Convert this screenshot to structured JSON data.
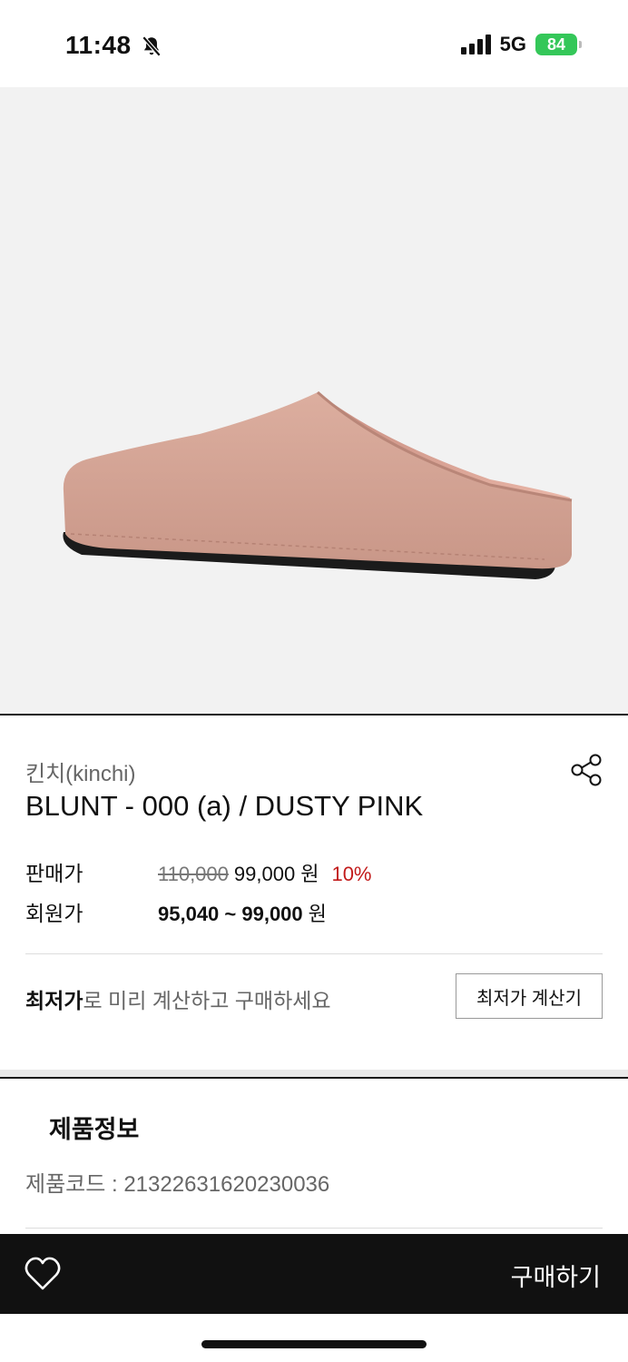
{
  "status_bar": {
    "time": "11:48",
    "network": "5G",
    "battery": "84",
    "icons": [
      "bell-slash-icon",
      "signal-icon",
      "battery-charging-icon"
    ]
  },
  "product": {
    "image_alt": "dusty pink suede mule clog",
    "brand": "킨치(kinchi)",
    "name": "BLUNT - 000 (a) / DUSTY PINK",
    "price_label": "판매가",
    "original_price": "110,000",
    "sale_price": "99,000",
    "currency": "원",
    "discount": "10%",
    "member_label": "회원가",
    "member_price": "95,040 ~ 99,000"
  },
  "lowest_price": {
    "bold": "최저가",
    "rest": "로 미리 계산하고 구매하세요",
    "button": "최저가 계산기"
  },
  "info": {
    "title": "제품정보",
    "code_label": "제품코드 : ",
    "code_value": "21322631620230036"
  },
  "bottom_bar": {
    "buy_label": "구매하기",
    "wishlist_icon": "heart-icon"
  },
  "colors": {
    "accent_discount": "#c21a1a",
    "battery": "#34c759",
    "bottom_bar": "#111111",
    "shoe": "#d9aa9b"
  }
}
